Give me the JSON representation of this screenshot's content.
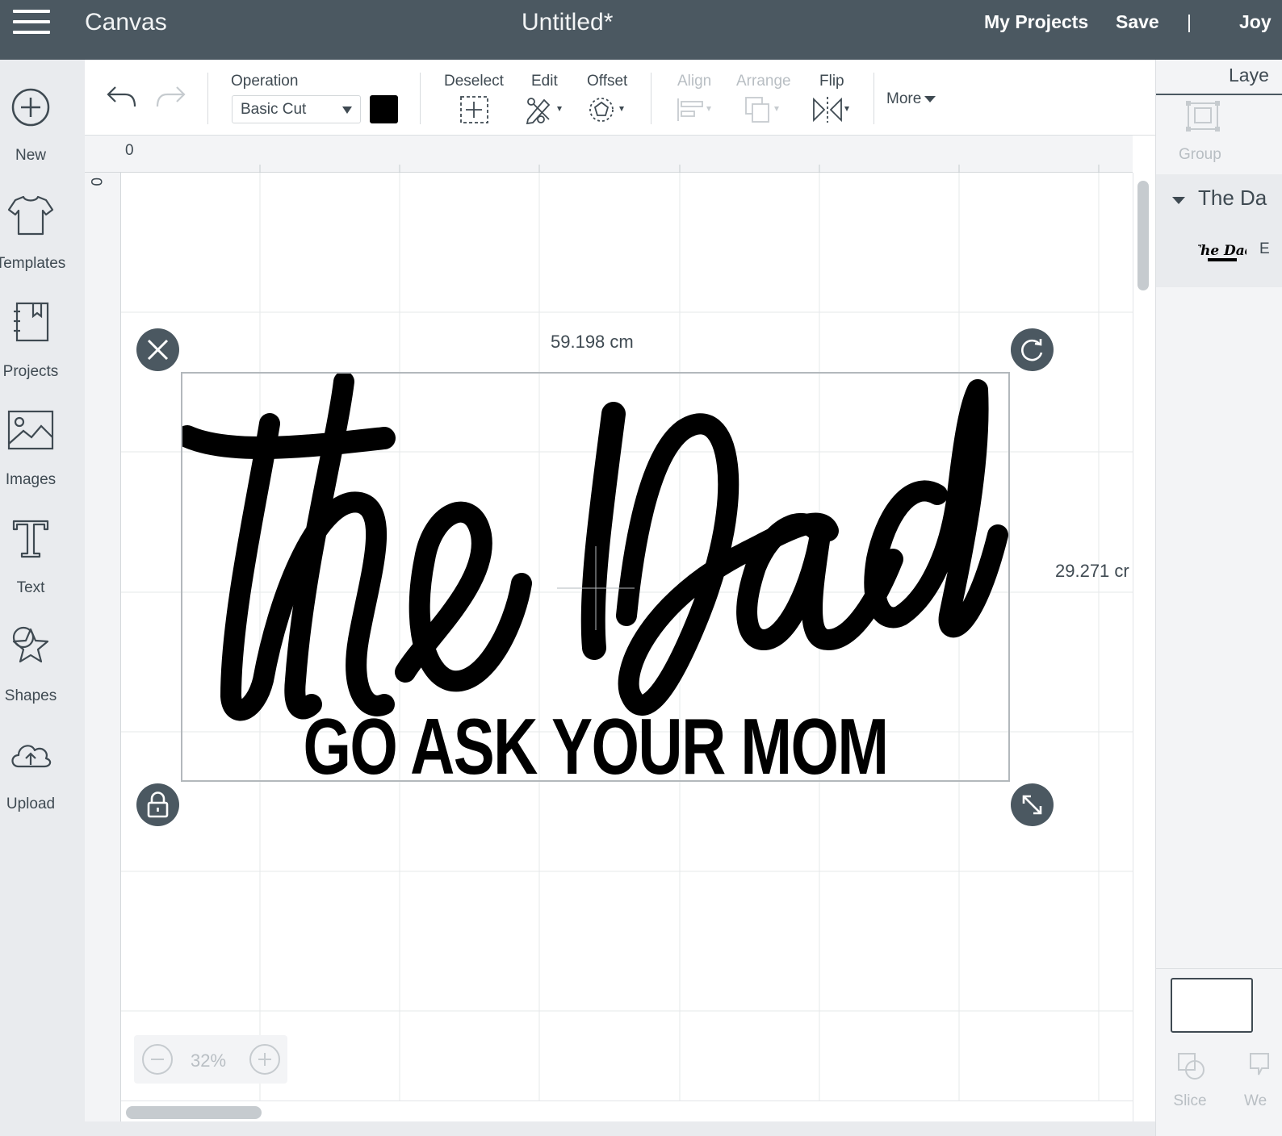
{
  "topbar": {
    "app_title": "Canvas",
    "doc_title": "Untitled*",
    "my_projects": "My Projects",
    "save": "Save",
    "divider": "|",
    "user": "Joy"
  },
  "sidebar": {
    "items": [
      {
        "label": "New",
        "icon": "plus-circle-icon"
      },
      {
        "label": "Templates",
        "icon": "tshirt-icon"
      },
      {
        "label": "Projects",
        "icon": "notebook-icon"
      },
      {
        "label": "Images",
        "icon": "image-icon"
      },
      {
        "label": "Text",
        "icon": "text-t-icon"
      },
      {
        "label": "Shapes",
        "icon": "shapes-icon"
      },
      {
        "label": "Upload",
        "icon": "cloud-upload-icon"
      }
    ]
  },
  "toolbar": {
    "operation_label": "Operation",
    "operation_value": "Basic Cut",
    "operation_color": "#000000",
    "deselect": "Deselect",
    "edit": "Edit",
    "offset": "Offset",
    "align": "Align",
    "arrange": "Arrange",
    "flip": "Flip",
    "more": "More"
  },
  "rulers": {
    "top_zero": "0",
    "left_zero": "0"
  },
  "canvas": {
    "design_title": "the Dad",
    "design_subtitle": "GO ASK YOUR MOM",
    "width_label": "59.198 cm",
    "height_label": "29.271 cr"
  },
  "zoom": {
    "value": "32%"
  },
  "layers": {
    "title": "Laye",
    "group": "Group",
    "group_name": "The Da",
    "thumb_text": "The Dad",
    "thumb_cut": "E",
    "slice": "Slice",
    "weld": "We"
  }
}
